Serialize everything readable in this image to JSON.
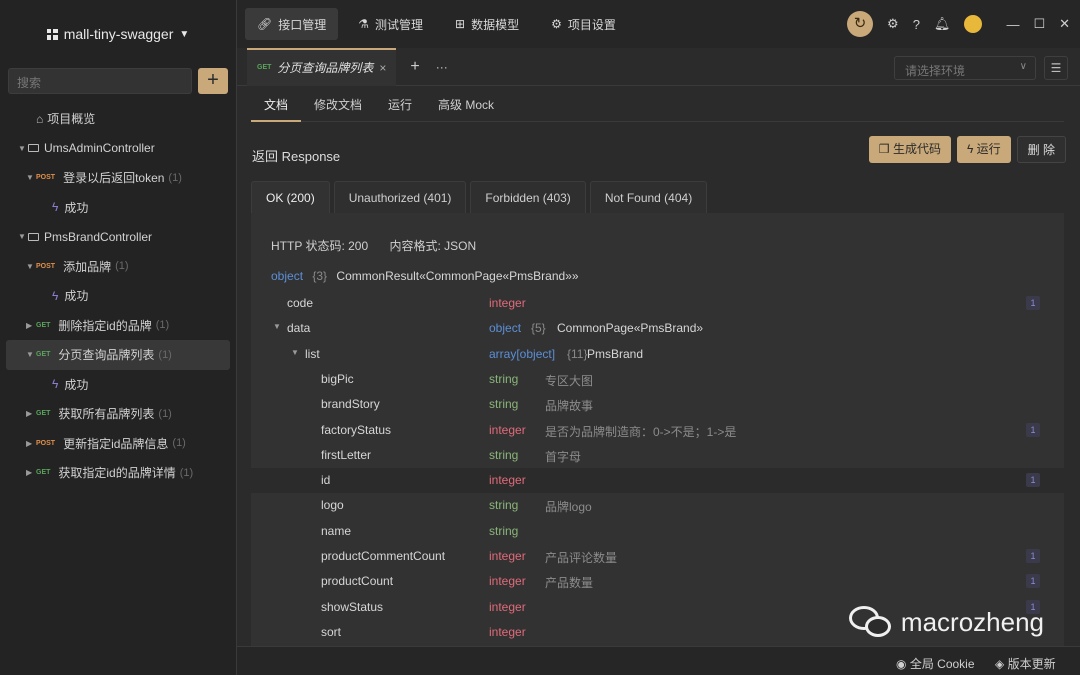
{
  "sidebar": {
    "project_name": "mall-tiny-swagger",
    "search_placeholder": "搜索",
    "add_label": "+",
    "overview": "项目概览",
    "tree": [
      {
        "kind": "folder",
        "label": "UmsAdminController",
        "indent": 18
      },
      {
        "kind": "api",
        "method": "POST",
        "label": "登录以后返回token",
        "count": "(1)",
        "indent": 26
      },
      {
        "kind": "resp",
        "label": "成功",
        "indent": 52
      },
      {
        "kind": "folder",
        "label": "PmsBrandController",
        "indent": 18
      },
      {
        "kind": "api",
        "method": "POST",
        "label": "添加品牌",
        "count": "(1)",
        "indent": 26
      },
      {
        "kind": "resp",
        "label": "成功",
        "indent": 52
      },
      {
        "kind": "api",
        "method": "GET",
        "label": "删除指定id的品牌",
        "count": "(1)",
        "indent": 26,
        "collapsed": true
      },
      {
        "kind": "api",
        "method": "GET",
        "label": "分页查询品牌列表",
        "count": "(1)",
        "indent": 20,
        "active": true
      },
      {
        "kind": "resp",
        "label": "成功",
        "indent": 52
      },
      {
        "kind": "api",
        "method": "GET",
        "label": "获取所有品牌列表",
        "count": "(1)",
        "indent": 26,
        "collapsed": true
      },
      {
        "kind": "api",
        "method": "POST",
        "label": "更新指定id品牌信息",
        "count": "(1)",
        "indent": 26,
        "collapsed": true
      },
      {
        "kind": "api",
        "method": "GET",
        "label": "获取指定id的品牌详情",
        "count": "(1)",
        "indent": 26,
        "collapsed": true
      }
    ]
  },
  "topbar": {
    "tabs": [
      "接口管理",
      "测试管理",
      "数据模型",
      "项目设置"
    ]
  },
  "reqbar": {
    "method": "GET",
    "tab_title": "分页查询品牌列表",
    "close": "×",
    "add": "+",
    "more": "···",
    "env_placeholder": "请选择环境"
  },
  "doc_tabs": [
    "文档",
    "修改文档",
    "运行",
    "高级 Mock"
  ],
  "response": {
    "title": "返回 Response",
    "buttons": {
      "gen": "生成代码",
      "run": "运行",
      "delete": "删 除"
    },
    "code_tabs": [
      "OK (200)",
      "Unauthorized (401)",
      "Forbidden (403)",
      "Not Found (404)"
    ],
    "status_line": "HTTP 状态码: 200",
    "format_line": "内容格式: JSON",
    "root_type": "object",
    "root_count": "{3}",
    "root_name": "CommonResult«CommonPage«PmsBrand»»",
    "fields": [
      {
        "name": "code",
        "type": "integer",
        "desc": "",
        "badge": "1",
        "indent": 36
      },
      {
        "name": "data",
        "type": "object",
        "type_suffix": "{5}",
        "desc": "CommonPage«PmsBrand»",
        "indent": 36,
        "caret": true
      },
      {
        "name": "list",
        "type": "array[object]",
        "type_suffix": "{11}",
        "desc": "PmsBrand",
        "indent": 54,
        "caret": true
      },
      {
        "name": "bigPic",
        "type": "string",
        "desc": "专区大图",
        "indent": 70
      },
      {
        "name": "brandStory",
        "type": "string",
        "desc": "品牌故事",
        "indent": 70
      },
      {
        "name": "factoryStatus",
        "type": "integer",
        "desc": "是否为品牌制造商：0->不是；1->是",
        "badge": "1",
        "indent": 70
      },
      {
        "name": "firstLetter",
        "type": "string",
        "desc": "首字母",
        "indent": 70
      },
      {
        "name": "id",
        "type": "integer",
        "desc": "",
        "badge": "1",
        "indent": 70,
        "hl": true
      },
      {
        "name": "logo",
        "type": "string",
        "desc": "品牌logo",
        "indent": 70
      },
      {
        "name": "name",
        "type": "string",
        "desc": "",
        "indent": 70
      },
      {
        "name": "productCommentCount",
        "type": "integer",
        "desc": "产品评论数量",
        "badge": "1",
        "indent": 70
      },
      {
        "name": "productCount",
        "type": "integer",
        "desc": "产品数量",
        "badge": "1",
        "indent": 70
      },
      {
        "name": "showStatus",
        "type": "integer",
        "desc": "",
        "badge": "1",
        "indent": 70
      },
      {
        "name": "sort",
        "type": "integer",
        "desc": "",
        "indent": 70
      }
    ]
  },
  "footer": {
    "cookie": "全局 Cookie",
    "update": "版本更新"
  },
  "watermark": "macrozheng"
}
